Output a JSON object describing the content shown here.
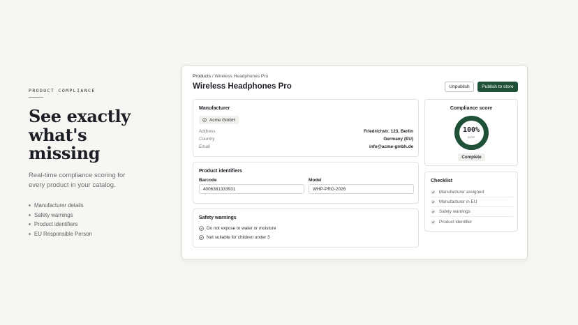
{
  "marketing": {
    "eyebrow": "PRODUCT COMPLIANCE",
    "headline_lines": [
      "See exactly",
      "what's",
      "missing"
    ],
    "subtitle": "Real-time compliance scoring for every product in your catalog.",
    "bullets": [
      "Manufacturer details",
      "Safety warnings",
      "Product identifiers",
      "EU Responsible Person"
    ]
  },
  "app": {
    "breadcrumb": {
      "root": "Products",
      "separator": " / ",
      "current": "Wireless Headphones Pro"
    },
    "title": "Wireless Headphones Pro",
    "actions": {
      "unpublish_label": "Unpublish",
      "publish_label": "Publish to store"
    },
    "manufacturer": {
      "title": "Manufacturer",
      "chip_icon": "check-circle-icon",
      "chip_label": "Acme GmbH",
      "rows": [
        {
          "key": "Address",
          "value": "Friedrichstr. 123, Berlin"
        },
        {
          "key": "Country",
          "value": "Germany (EU)"
        },
        {
          "key": "Email",
          "value": "info@acme-gmbh.de"
        }
      ]
    },
    "identifiers": {
      "title": "Product identifiers",
      "barcode_label": "Barcode",
      "barcode_value": "4006381333931",
      "model_label": "Model",
      "model_value": "WHP-PRO-2026"
    },
    "safety": {
      "title": "Safety warnings",
      "items": [
        "Do not expose to water or moisture",
        "Not suitable for children under 3"
      ]
    },
    "score": {
      "title": "Compliance score",
      "value": "100%",
      "percent": 100,
      "caption": "score",
      "status": "Complete",
      "ring_color": "#1f5138"
    },
    "checklist": {
      "title": "Checklist",
      "items": [
        "Manufacturer assigned",
        "Manufacturer in EU",
        "Safety warnings",
        "Product identifier"
      ]
    }
  },
  "colors": {
    "accent": "#1f5138",
    "background": "#f7f6f2"
  }
}
